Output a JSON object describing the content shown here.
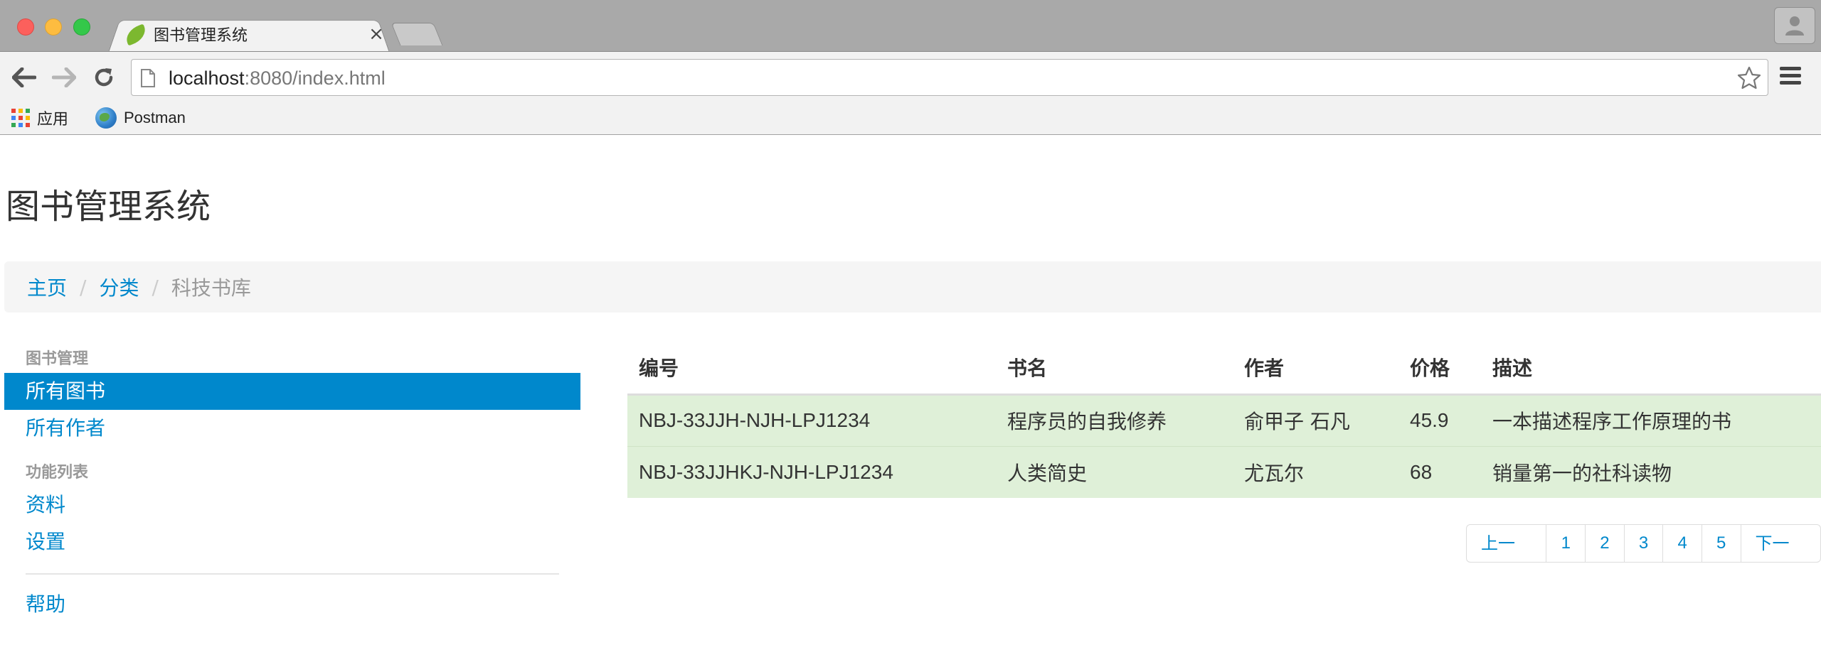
{
  "browser": {
    "tab_title": "图书管理系统",
    "tab_close": "×",
    "url_host": "localhost",
    "url_path": ":8080/index.html",
    "bookmarks": [
      {
        "label": "应用",
        "icon": "apps-grid-icon"
      },
      {
        "label": "Postman",
        "icon": "globe-icon"
      }
    ],
    "colors": {
      "titlebar": "#a9a9a9",
      "toolbar": "#f2f2f2"
    }
  },
  "page": {
    "title": "图书管理系统",
    "breadcrumb": {
      "home": "主页",
      "category": "分类",
      "current": "科技书库",
      "separator": "/"
    },
    "sidebar": {
      "section1_header": "图书管理",
      "all_books": "所有图书",
      "all_authors": "所有作者",
      "section2_header": "功能列表",
      "profile": "资料",
      "settings": "设置",
      "help": "帮助"
    },
    "table": {
      "headers": {
        "code": "编号",
        "name": "书名",
        "author": "作者",
        "price": "价格",
        "desc": "描述"
      },
      "rows": [
        {
          "code": "NBJ-33JJH-NJH-LPJ1234",
          "name": "程序员的自我修养",
          "author": "俞甲子 石凡",
          "price": "45.9",
          "desc": "一本描述程序工作原理的书"
        },
        {
          "code": "NBJ-33JJHKJ-NJH-LPJ1234",
          "name": "人类简史",
          "author": "尤瓦尔",
          "price": "68",
          "desc": "销量第一的社科读物"
        }
      ]
    },
    "pagination": {
      "prev": "上一页",
      "pages": [
        "1",
        "2",
        "3",
        "4",
        "5"
      ],
      "next": "下一页"
    },
    "colors": {
      "link": "#0088cc",
      "active_nav": "#0088cc",
      "row_success": "#dff0d8",
      "breadcrumb_bg": "#f5f5f5"
    }
  }
}
